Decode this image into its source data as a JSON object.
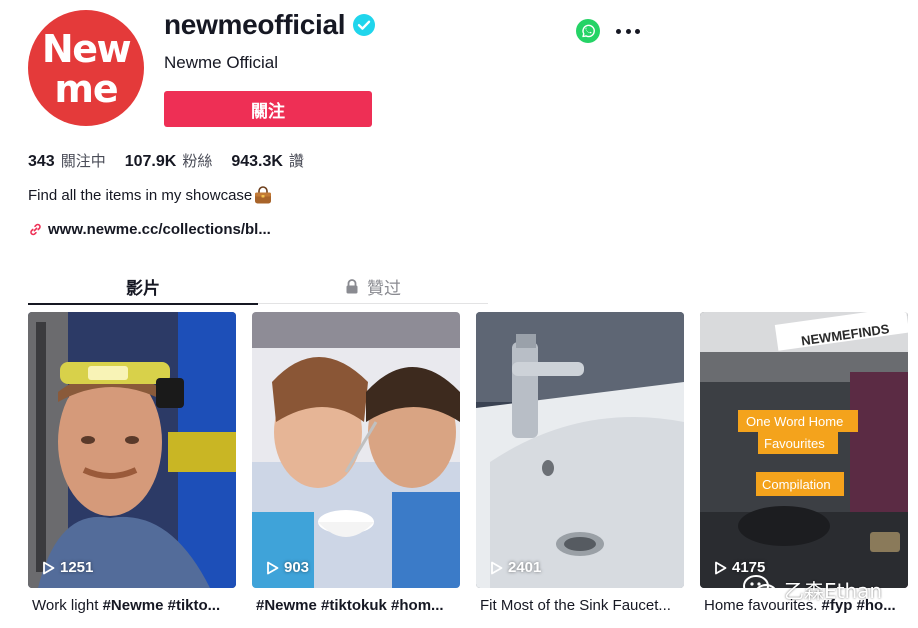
{
  "profile": {
    "avatar_line1": "New",
    "avatar_line2": "me",
    "username": "newmeofficial",
    "display_name": "Newme Official",
    "follow_label": "關注"
  },
  "stats": [
    {
      "value": "343",
      "label": "關注中"
    },
    {
      "value": "107.9K",
      "label": "粉絲"
    },
    {
      "value": "943.3K",
      "label": "讚"
    }
  ],
  "bio": "Find all the items in my showcase",
  "link": "www.newme.cc/collections/bl...",
  "tabs": {
    "videos": "影片",
    "liked": "贊过"
  },
  "videos": [
    {
      "plays": "1251",
      "caption_plain": "Work light ",
      "caption_tags": "#Newme #tikto..."
    },
    {
      "plays": "903",
      "caption_plain": "",
      "caption_tags": "#Newme #tiktokuk #hom..."
    },
    {
      "plays": "2401",
      "caption_plain": "Fit Most of the Sink Faucet...",
      "caption_tags": ""
    },
    {
      "plays": "4175",
      "caption_plain": "Home favourites. ",
      "caption_tags": "#fyp #ho..."
    }
  ],
  "overlays": {
    "sign_text": "NEWMEFINDS",
    "label1_line1": "One Word Home",
    "label1_line2": "Favourites",
    "label2": "Compilation"
  },
  "watermark": "乙森Ethan",
  "colors": {
    "brand_red": "#e43a3a",
    "follow_button": "#ee2f55",
    "verified": "#20d5ec",
    "whatsapp": "#25d366"
  },
  "icons": [
    "verified-icon",
    "whatsapp-icon",
    "more-icon",
    "bag-emoji-icon",
    "link-icon",
    "lock-icon",
    "play-icon",
    "wechat-icon"
  ]
}
